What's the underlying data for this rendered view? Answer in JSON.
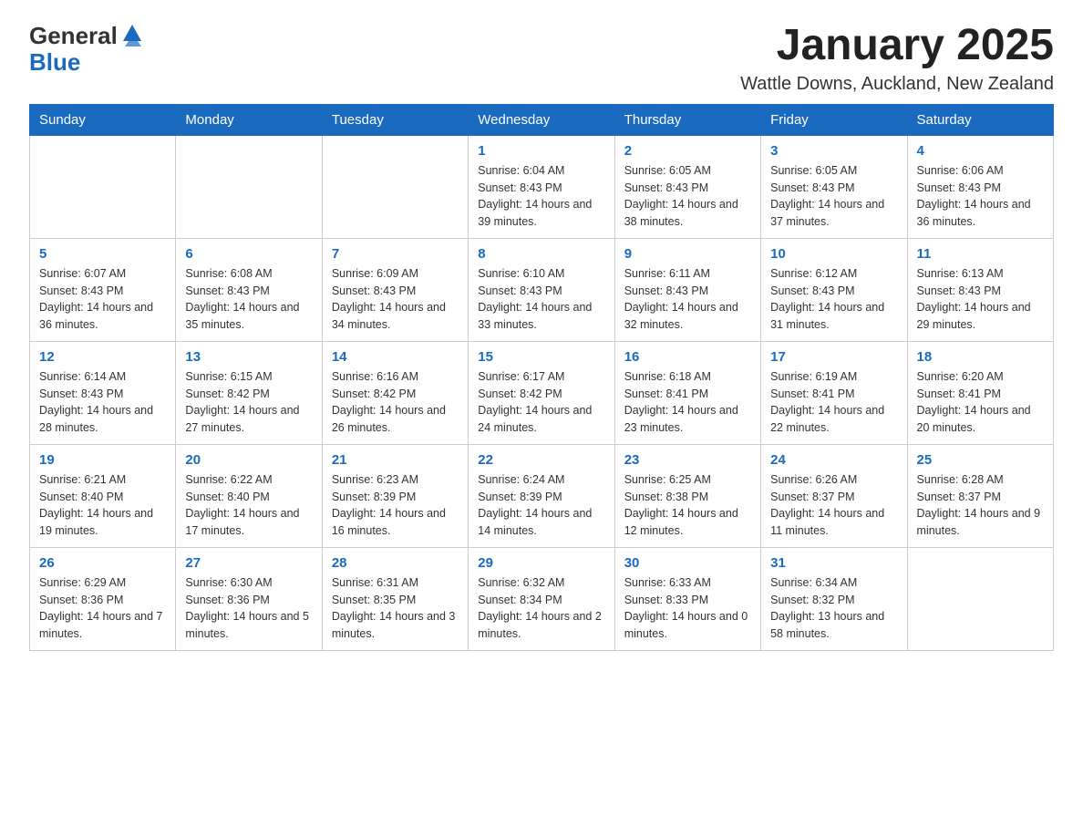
{
  "header": {
    "logo_general": "General",
    "logo_blue": "Blue",
    "month_title": "January 2025",
    "location": "Wattle Downs, Auckland, New Zealand"
  },
  "weekdays": [
    "Sunday",
    "Monday",
    "Tuesday",
    "Wednesday",
    "Thursday",
    "Friday",
    "Saturday"
  ],
  "weeks": [
    [
      {
        "day": "",
        "info": ""
      },
      {
        "day": "",
        "info": ""
      },
      {
        "day": "",
        "info": ""
      },
      {
        "day": "1",
        "info": "Sunrise: 6:04 AM\nSunset: 8:43 PM\nDaylight: 14 hours and 39 minutes."
      },
      {
        "day": "2",
        "info": "Sunrise: 6:05 AM\nSunset: 8:43 PM\nDaylight: 14 hours and 38 minutes."
      },
      {
        "day": "3",
        "info": "Sunrise: 6:05 AM\nSunset: 8:43 PM\nDaylight: 14 hours and 37 minutes."
      },
      {
        "day": "4",
        "info": "Sunrise: 6:06 AM\nSunset: 8:43 PM\nDaylight: 14 hours and 36 minutes."
      }
    ],
    [
      {
        "day": "5",
        "info": "Sunrise: 6:07 AM\nSunset: 8:43 PM\nDaylight: 14 hours and 36 minutes."
      },
      {
        "day": "6",
        "info": "Sunrise: 6:08 AM\nSunset: 8:43 PM\nDaylight: 14 hours and 35 minutes."
      },
      {
        "day": "7",
        "info": "Sunrise: 6:09 AM\nSunset: 8:43 PM\nDaylight: 14 hours and 34 minutes."
      },
      {
        "day": "8",
        "info": "Sunrise: 6:10 AM\nSunset: 8:43 PM\nDaylight: 14 hours and 33 minutes."
      },
      {
        "day": "9",
        "info": "Sunrise: 6:11 AM\nSunset: 8:43 PM\nDaylight: 14 hours and 32 minutes."
      },
      {
        "day": "10",
        "info": "Sunrise: 6:12 AM\nSunset: 8:43 PM\nDaylight: 14 hours and 31 minutes."
      },
      {
        "day": "11",
        "info": "Sunrise: 6:13 AM\nSunset: 8:43 PM\nDaylight: 14 hours and 29 minutes."
      }
    ],
    [
      {
        "day": "12",
        "info": "Sunrise: 6:14 AM\nSunset: 8:43 PM\nDaylight: 14 hours and 28 minutes."
      },
      {
        "day": "13",
        "info": "Sunrise: 6:15 AM\nSunset: 8:42 PM\nDaylight: 14 hours and 27 minutes."
      },
      {
        "day": "14",
        "info": "Sunrise: 6:16 AM\nSunset: 8:42 PM\nDaylight: 14 hours and 26 minutes."
      },
      {
        "day": "15",
        "info": "Sunrise: 6:17 AM\nSunset: 8:42 PM\nDaylight: 14 hours and 24 minutes."
      },
      {
        "day": "16",
        "info": "Sunrise: 6:18 AM\nSunset: 8:41 PM\nDaylight: 14 hours and 23 minutes."
      },
      {
        "day": "17",
        "info": "Sunrise: 6:19 AM\nSunset: 8:41 PM\nDaylight: 14 hours and 22 minutes."
      },
      {
        "day": "18",
        "info": "Sunrise: 6:20 AM\nSunset: 8:41 PM\nDaylight: 14 hours and 20 minutes."
      }
    ],
    [
      {
        "day": "19",
        "info": "Sunrise: 6:21 AM\nSunset: 8:40 PM\nDaylight: 14 hours and 19 minutes."
      },
      {
        "day": "20",
        "info": "Sunrise: 6:22 AM\nSunset: 8:40 PM\nDaylight: 14 hours and 17 minutes."
      },
      {
        "day": "21",
        "info": "Sunrise: 6:23 AM\nSunset: 8:39 PM\nDaylight: 14 hours and 16 minutes."
      },
      {
        "day": "22",
        "info": "Sunrise: 6:24 AM\nSunset: 8:39 PM\nDaylight: 14 hours and 14 minutes."
      },
      {
        "day": "23",
        "info": "Sunrise: 6:25 AM\nSunset: 8:38 PM\nDaylight: 14 hours and 12 minutes."
      },
      {
        "day": "24",
        "info": "Sunrise: 6:26 AM\nSunset: 8:37 PM\nDaylight: 14 hours and 11 minutes."
      },
      {
        "day": "25",
        "info": "Sunrise: 6:28 AM\nSunset: 8:37 PM\nDaylight: 14 hours and 9 minutes."
      }
    ],
    [
      {
        "day": "26",
        "info": "Sunrise: 6:29 AM\nSunset: 8:36 PM\nDaylight: 14 hours and 7 minutes."
      },
      {
        "day": "27",
        "info": "Sunrise: 6:30 AM\nSunset: 8:36 PM\nDaylight: 14 hours and 5 minutes."
      },
      {
        "day": "28",
        "info": "Sunrise: 6:31 AM\nSunset: 8:35 PM\nDaylight: 14 hours and 3 minutes."
      },
      {
        "day": "29",
        "info": "Sunrise: 6:32 AM\nSunset: 8:34 PM\nDaylight: 14 hours and 2 minutes."
      },
      {
        "day": "30",
        "info": "Sunrise: 6:33 AM\nSunset: 8:33 PM\nDaylight: 14 hours and 0 minutes."
      },
      {
        "day": "31",
        "info": "Sunrise: 6:34 AM\nSunset: 8:32 PM\nDaylight: 13 hours and 58 minutes."
      },
      {
        "day": "",
        "info": ""
      }
    ]
  ]
}
